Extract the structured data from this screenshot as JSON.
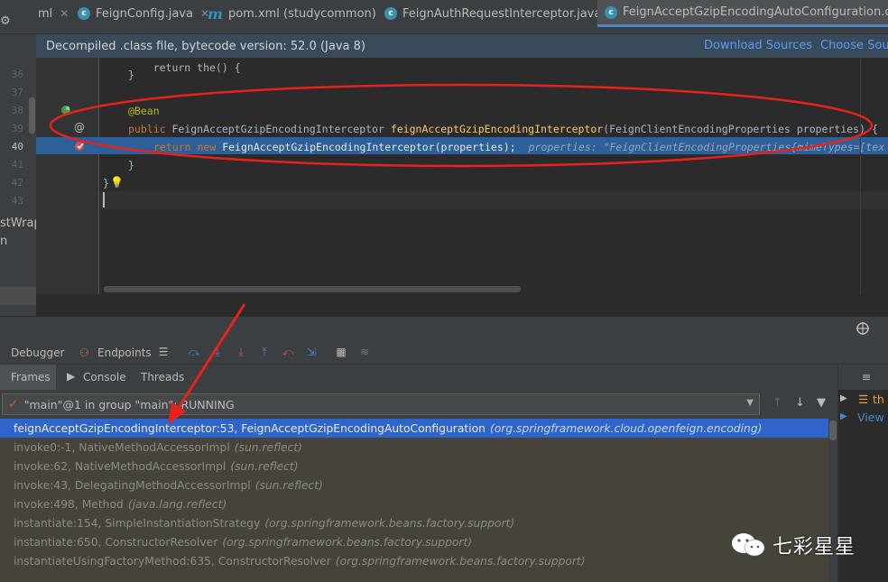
{
  "tabs": [
    {
      "label": "ml",
      "icon": "none"
    },
    {
      "label": "FeignConfig.java",
      "icon": "class-icon"
    },
    {
      "label": "pom.xml (studycommon)",
      "icon": "maven-icon"
    },
    {
      "label": "FeignAuthRequestInterceptor.java",
      "icon": "class-icon"
    },
    {
      "label": "FeignAcceptGzipEncodingAutoConfiguration.class",
      "icon": "class-icon"
    }
  ],
  "banner": {
    "message": "Decompiled .class file, bytecode version: 52.0 (Java 8)",
    "download_sources": "Download Sources",
    "choose_sources": "Choose Sour"
  },
  "project_panel": {
    "item1": "stWrap",
    "item2": "n"
  },
  "editor": {
    "line_numbers": [
      "36",
      "37",
      "38",
      "39",
      "40",
      "41",
      "42",
      "43"
    ],
    "line36": "}",
    "line38_annotation": "@Bean",
    "line39_kw": "public",
    "line39_type": "FeignAcceptGzipEncodingInterceptor",
    "line39_method": "feignAcceptGzipEncodingInterceptor",
    "line39_params": "(FeignClientEncodingProperties properties) {",
    "line40_return": "return",
    "line40_new": "new",
    "line40_rest": "FeignAcceptGzipEncodingInterceptor(properties);",
    "line40_hint": "properties: \"FeignClientEncodingProperties{mimeTypes=[tex",
    "line41": "}",
    "line42": "}"
  },
  "debugger": {
    "tab_debugger": "Debugger",
    "tab_endpoints": "Endpoints",
    "subtab_frames": "Frames",
    "subtab_console": "Console",
    "subtab_threads": "Threads",
    "thread_selector": "\"main\"@1 in group \"main\": RUNNING",
    "frames": [
      {
        "method": "feignAcceptGzipEncodingInterceptor:53, FeignAcceptGzipEncodingAutoConfiguration",
        "pkg": "(org.springframework.cloud.openfeign.encoding)"
      },
      {
        "method": "invoke0:-1, NativeMethodAccessorImpl",
        "pkg": "(sun.reflect)"
      },
      {
        "method": "invoke:62, NativeMethodAccessorImpl",
        "pkg": "(sun.reflect)"
      },
      {
        "method": "invoke:43, DelegatingMethodAccessorImpl",
        "pkg": "(sun.reflect)"
      },
      {
        "method": "invoke:498, Method",
        "pkg": "(java.lang.reflect)"
      },
      {
        "method": "instantiate:154, SimpleInstantiationStrategy",
        "pkg": "(org.springframework.beans.factory.support)"
      },
      {
        "method": "instantiate:650, ConstructorResolver",
        "pkg": "(org.springframework.beans.factory.support)"
      },
      {
        "method": "instantiateUsingFactoryMethod:635, ConstructorResolver",
        "pkg": "(org.springframework.beans.factory.support)"
      }
    ],
    "right_pane_item": "th",
    "right_pane_view": "View"
  },
  "watermark": {
    "name": "七彩星星"
  },
  "colors": {
    "accent": "#4a88c7",
    "annotation_red": "#e8221b",
    "selected_frame": "#2f65ca",
    "exec_line": "#2d6099"
  }
}
